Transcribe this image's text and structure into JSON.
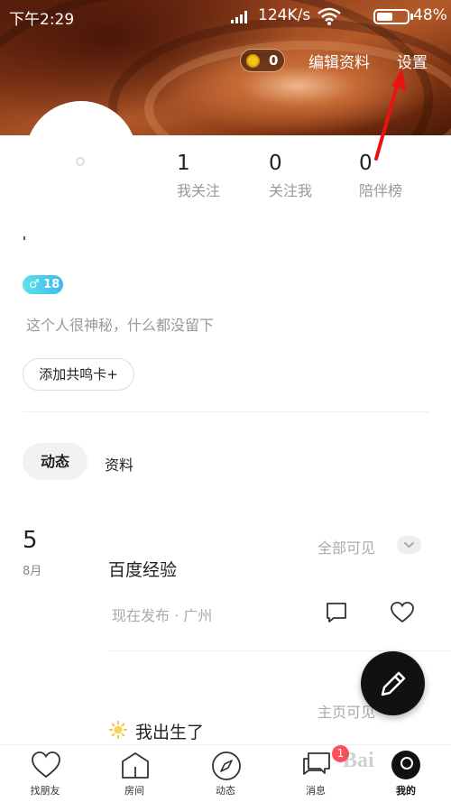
{
  "status_bar": {
    "time": "下午2:29",
    "speed": "124K/s",
    "battery": "48%"
  },
  "header": {
    "coins": "0",
    "edit_profile": "编辑资料",
    "settings": "设置"
  },
  "stats": [
    {
      "value": "1",
      "label": "我关注"
    },
    {
      "value": "0",
      "label": "关注我"
    },
    {
      "value": "0",
      "label": "陪伴榜"
    }
  ],
  "profile": {
    "gender_age": "♂ 18",
    "bio": "这个人很神秘，什么都没留下",
    "add_card": "添加共鸣卡+"
  },
  "tabs": {
    "feed": "动态",
    "profile": "资料"
  },
  "post": {
    "day": "5",
    "month": "8月",
    "visibility": "全部可见",
    "title": "百度经验",
    "meta": "现在发布 · 广州"
  },
  "post2": {
    "visibility": "主页可见",
    "title": "我出生了"
  },
  "bottom_nav": [
    {
      "label": "找朋友",
      "icon": "heart-icon"
    },
    {
      "label": "房间",
      "icon": "house-icon"
    },
    {
      "label": "动态",
      "icon": "compass-icon"
    },
    {
      "label": "消息",
      "icon": "chat-icon",
      "badge": "1"
    },
    {
      "label": "我的",
      "icon": "user-icon"
    }
  ],
  "watermark": "Bai"
}
